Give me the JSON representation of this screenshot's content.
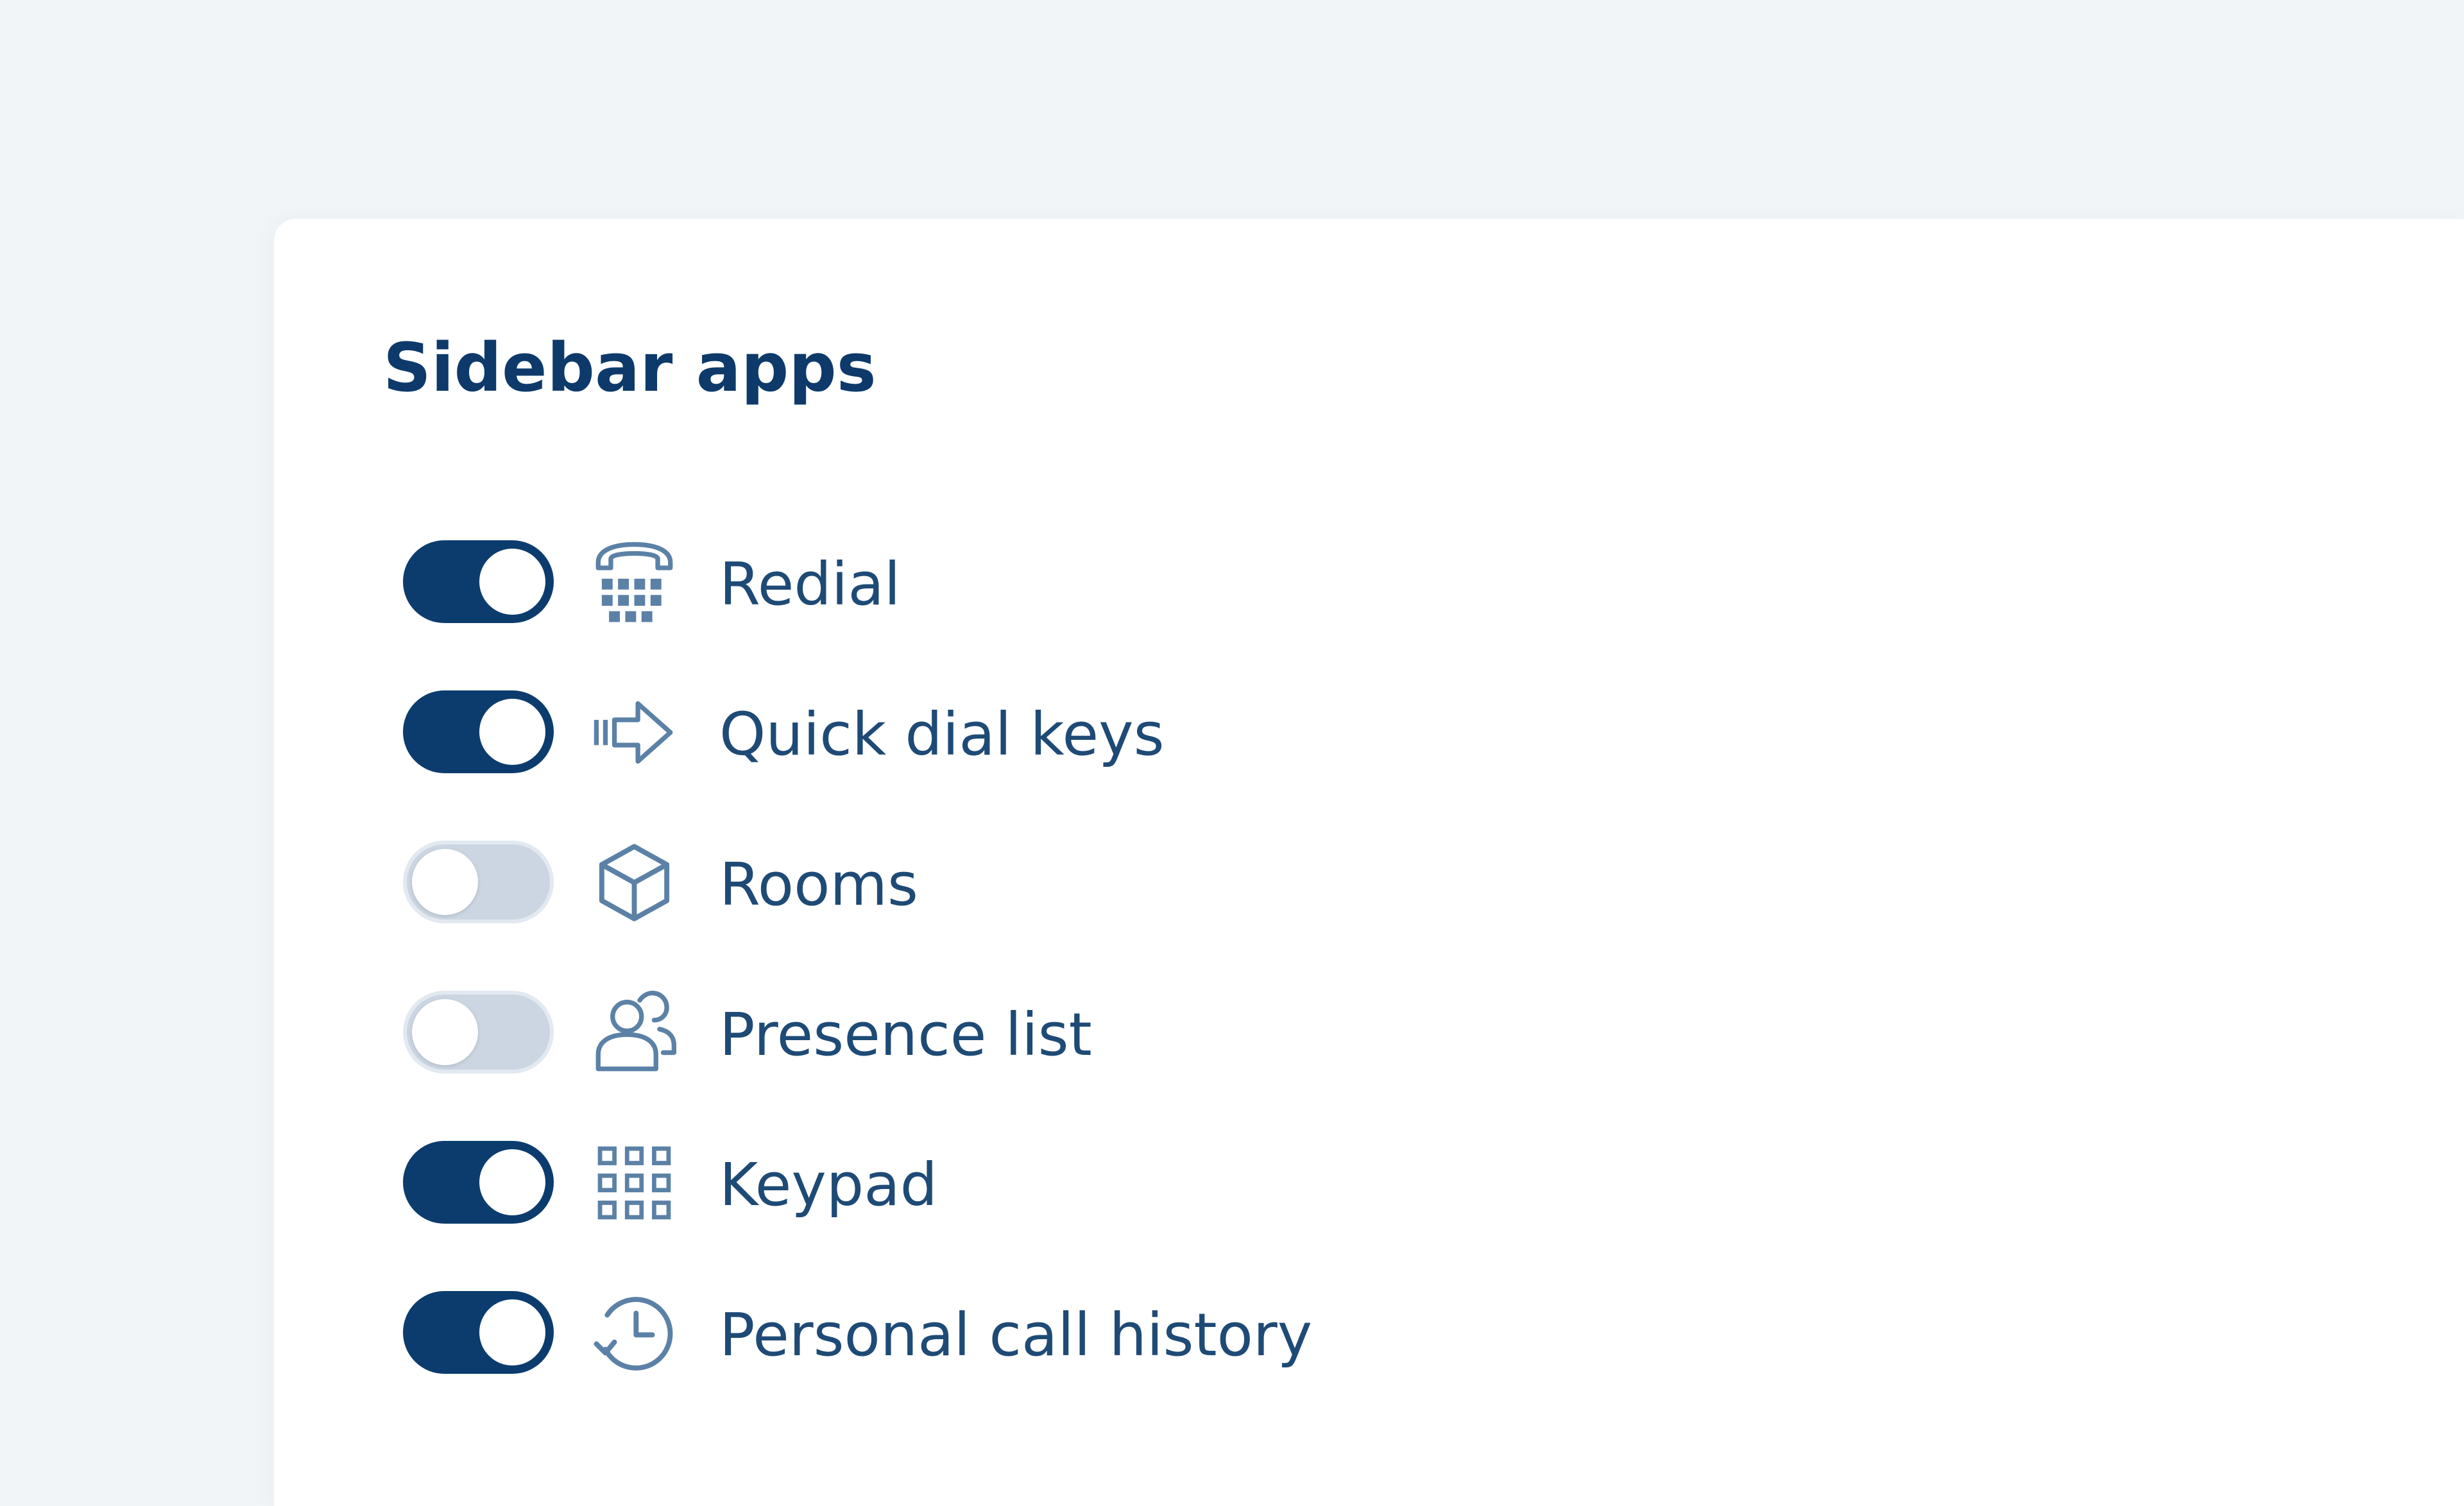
{
  "section": {
    "title": "Sidebar apps"
  },
  "apps": [
    {
      "label": "Redial",
      "enabled": true,
      "icon": "phone-keypad-icon"
    },
    {
      "label": "Quick dial keys",
      "enabled": true,
      "icon": "arrow-right-icon"
    },
    {
      "label": "Rooms",
      "enabled": false,
      "icon": "cube-icon"
    },
    {
      "label": "Presence list",
      "enabled": false,
      "icon": "users-icon"
    },
    {
      "label": "Keypad",
      "enabled": true,
      "icon": "keypad-grid-icon"
    },
    {
      "label": "Personal call history",
      "enabled": true,
      "icon": "clock-history-icon"
    }
  ],
  "colors": {
    "page_background": "#f1f5f8",
    "card_background": "#ffffff",
    "title": "#0d3a6a",
    "label": "#1e4a76",
    "toggle_on": "#0c3c6e",
    "toggle_off": "#cbd6e2",
    "icon": "#5b81a6"
  }
}
